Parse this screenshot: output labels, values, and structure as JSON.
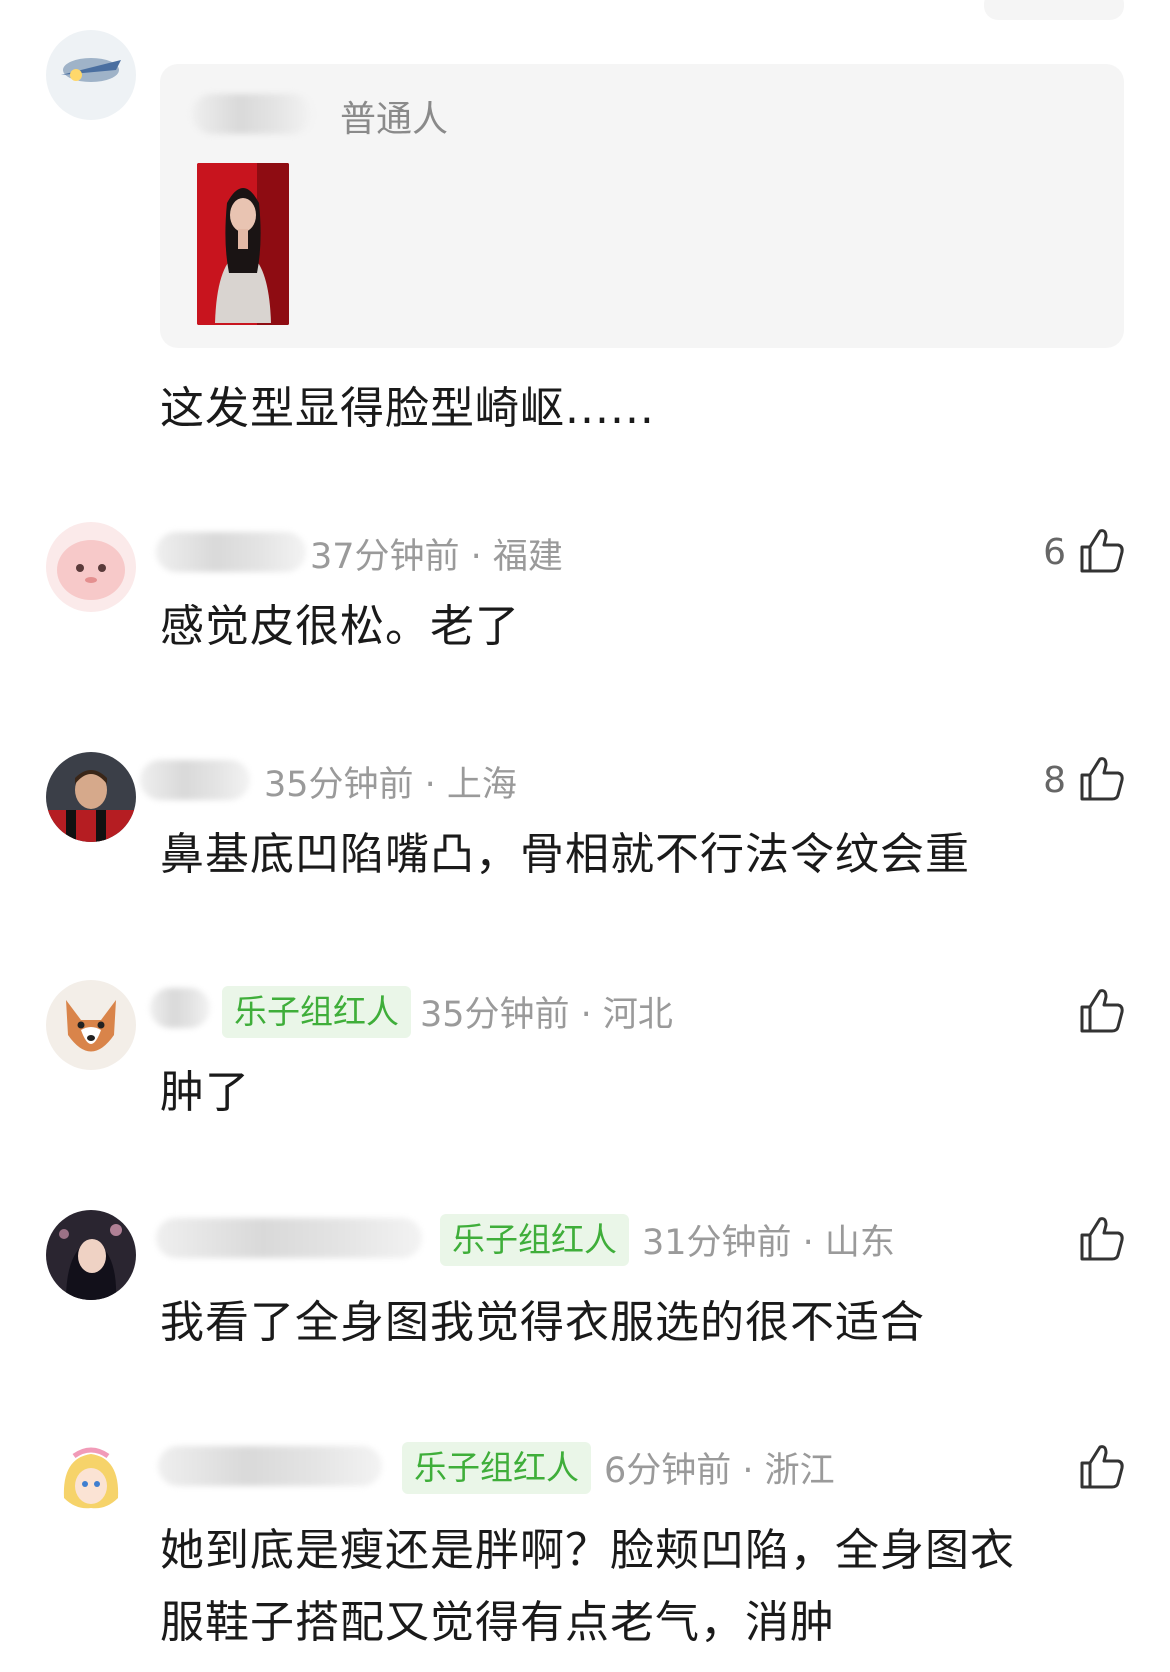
{
  "quoted": {
    "author_label": "普通人",
    "text": "这发型显得脸型崎岖......"
  },
  "comments": [
    {
      "meta": "37分钟前 · 福建",
      "text": "感觉皮很松。老了",
      "likes": "6",
      "badge": ""
    },
    {
      "meta": "35分钟前 · 上海",
      "text": "鼻基底凹陷嘴凸，骨相就不行法令纹会重",
      "likes": "8",
      "badge": ""
    },
    {
      "meta": "35分钟前 · 河北",
      "text": "肿了",
      "likes": "",
      "badge": "乐子组红人"
    },
    {
      "meta": "31分钟前 · 山东",
      "text": "我看了全身图我觉得衣服选的很不适合",
      "likes": "",
      "badge": "乐子组红人"
    },
    {
      "meta": "6分钟前 · 浙江",
      "text_line1": "她到底是瘦还是胖啊？脸颊凹陷，全身图衣",
      "text_line2": "服鞋子搭配又觉得有点老气，消肿",
      "likes": "",
      "badge": "乐子组红人"
    }
  ],
  "icons": {
    "like": "thumbs-up-icon"
  },
  "colors": {
    "badge_text": "#3fae3a",
    "badge_bg": "#eaf6e8",
    "meta_text": "#9a9a9a"
  }
}
